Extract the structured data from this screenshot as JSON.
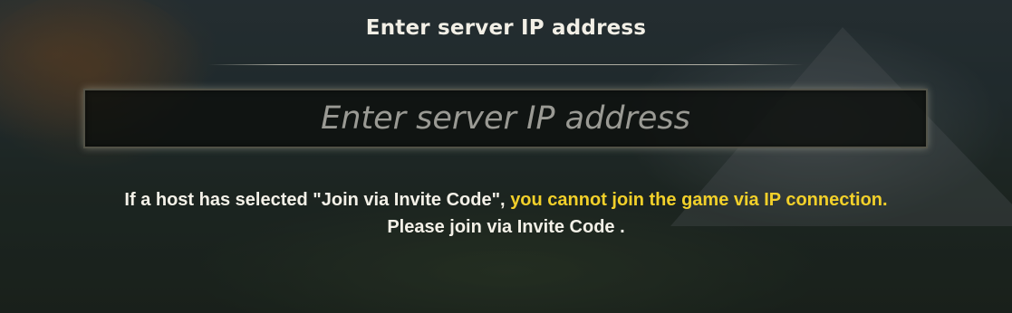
{
  "dialog": {
    "title": "Enter server IP address",
    "ip_input": {
      "value": "",
      "placeholder": "Enter server IP address"
    },
    "notice": {
      "line1_part1": "If a host has selected \"Join via Invite Code\",",
      "line1_highlight": "you cannot join the game via IP connection.",
      "line2": "Please join via Invite Code ."
    }
  },
  "colors": {
    "title_text": "#f2efe6",
    "warning_text": "#f2d02a",
    "placeholder_text": "#9a9a94",
    "field_background": "#0e100e"
  }
}
